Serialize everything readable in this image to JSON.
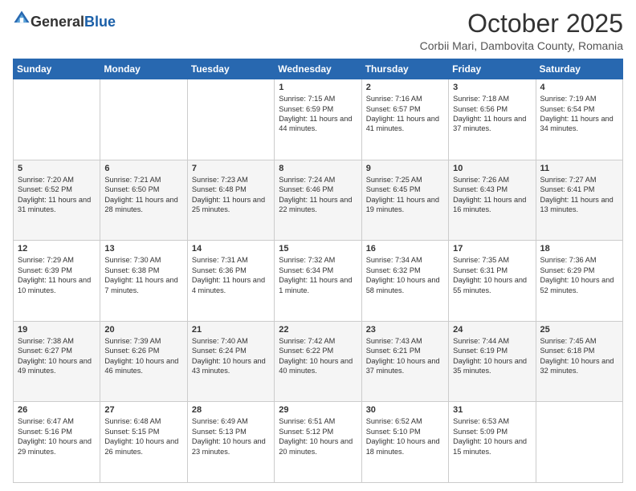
{
  "header": {
    "logo_general": "General",
    "logo_blue": "Blue",
    "title": "October 2025",
    "subtitle": "Corbii Mari, Dambovita County, Romania"
  },
  "columns": [
    "Sunday",
    "Monday",
    "Tuesday",
    "Wednesday",
    "Thursday",
    "Friday",
    "Saturday"
  ],
  "weeks": [
    [
      {
        "day": "",
        "info": ""
      },
      {
        "day": "",
        "info": ""
      },
      {
        "day": "",
        "info": ""
      },
      {
        "day": "1",
        "info": "Sunrise: 7:15 AM\nSunset: 6:59 PM\nDaylight: 11 hours and 44 minutes."
      },
      {
        "day": "2",
        "info": "Sunrise: 7:16 AM\nSunset: 6:57 PM\nDaylight: 11 hours and 41 minutes."
      },
      {
        "day": "3",
        "info": "Sunrise: 7:18 AM\nSunset: 6:56 PM\nDaylight: 11 hours and 37 minutes."
      },
      {
        "day": "4",
        "info": "Sunrise: 7:19 AM\nSunset: 6:54 PM\nDaylight: 11 hours and 34 minutes."
      }
    ],
    [
      {
        "day": "5",
        "info": "Sunrise: 7:20 AM\nSunset: 6:52 PM\nDaylight: 11 hours and 31 minutes."
      },
      {
        "day": "6",
        "info": "Sunrise: 7:21 AM\nSunset: 6:50 PM\nDaylight: 11 hours and 28 minutes."
      },
      {
        "day": "7",
        "info": "Sunrise: 7:23 AM\nSunset: 6:48 PM\nDaylight: 11 hours and 25 minutes."
      },
      {
        "day": "8",
        "info": "Sunrise: 7:24 AM\nSunset: 6:46 PM\nDaylight: 11 hours and 22 minutes."
      },
      {
        "day": "9",
        "info": "Sunrise: 7:25 AM\nSunset: 6:45 PM\nDaylight: 11 hours and 19 minutes."
      },
      {
        "day": "10",
        "info": "Sunrise: 7:26 AM\nSunset: 6:43 PM\nDaylight: 11 hours and 16 minutes."
      },
      {
        "day": "11",
        "info": "Sunrise: 7:27 AM\nSunset: 6:41 PM\nDaylight: 11 hours and 13 minutes."
      }
    ],
    [
      {
        "day": "12",
        "info": "Sunrise: 7:29 AM\nSunset: 6:39 PM\nDaylight: 11 hours and 10 minutes."
      },
      {
        "day": "13",
        "info": "Sunrise: 7:30 AM\nSunset: 6:38 PM\nDaylight: 11 hours and 7 minutes."
      },
      {
        "day": "14",
        "info": "Sunrise: 7:31 AM\nSunset: 6:36 PM\nDaylight: 11 hours and 4 minutes."
      },
      {
        "day": "15",
        "info": "Sunrise: 7:32 AM\nSunset: 6:34 PM\nDaylight: 11 hours and 1 minute."
      },
      {
        "day": "16",
        "info": "Sunrise: 7:34 AM\nSunset: 6:32 PM\nDaylight: 10 hours and 58 minutes."
      },
      {
        "day": "17",
        "info": "Sunrise: 7:35 AM\nSunset: 6:31 PM\nDaylight: 10 hours and 55 minutes."
      },
      {
        "day": "18",
        "info": "Sunrise: 7:36 AM\nSunset: 6:29 PM\nDaylight: 10 hours and 52 minutes."
      }
    ],
    [
      {
        "day": "19",
        "info": "Sunrise: 7:38 AM\nSunset: 6:27 PM\nDaylight: 10 hours and 49 minutes."
      },
      {
        "day": "20",
        "info": "Sunrise: 7:39 AM\nSunset: 6:26 PM\nDaylight: 10 hours and 46 minutes."
      },
      {
        "day": "21",
        "info": "Sunrise: 7:40 AM\nSunset: 6:24 PM\nDaylight: 10 hours and 43 minutes."
      },
      {
        "day": "22",
        "info": "Sunrise: 7:42 AM\nSunset: 6:22 PM\nDaylight: 10 hours and 40 minutes."
      },
      {
        "day": "23",
        "info": "Sunrise: 7:43 AM\nSunset: 6:21 PM\nDaylight: 10 hours and 37 minutes."
      },
      {
        "day": "24",
        "info": "Sunrise: 7:44 AM\nSunset: 6:19 PM\nDaylight: 10 hours and 35 minutes."
      },
      {
        "day": "25",
        "info": "Sunrise: 7:45 AM\nSunset: 6:18 PM\nDaylight: 10 hours and 32 minutes."
      }
    ],
    [
      {
        "day": "26",
        "info": "Sunrise: 6:47 AM\nSunset: 5:16 PM\nDaylight: 10 hours and 29 minutes."
      },
      {
        "day": "27",
        "info": "Sunrise: 6:48 AM\nSunset: 5:15 PM\nDaylight: 10 hours and 26 minutes."
      },
      {
        "day": "28",
        "info": "Sunrise: 6:49 AM\nSunset: 5:13 PM\nDaylight: 10 hours and 23 minutes."
      },
      {
        "day": "29",
        "info": "Sunrise: 6:51 AM\nSunset: 5:12 PM\nDaylight: 10 hours and 20 minutes."
      },
      {
        "day": "30",
        "info": "Sunrise: 6:52 AM\nSunset: 5:10 PM\nDaylight: 10 hours and 18 minutes."
      },
      {
        "day": "31",
        "info": "Sunrise: 6:53 AM\nSunset: 5:09 PM\nDaylight: 10 hours and 15 minutes."
      },
      {
        "day": "",
        "info": ""
      }
    ]
  ]
}
